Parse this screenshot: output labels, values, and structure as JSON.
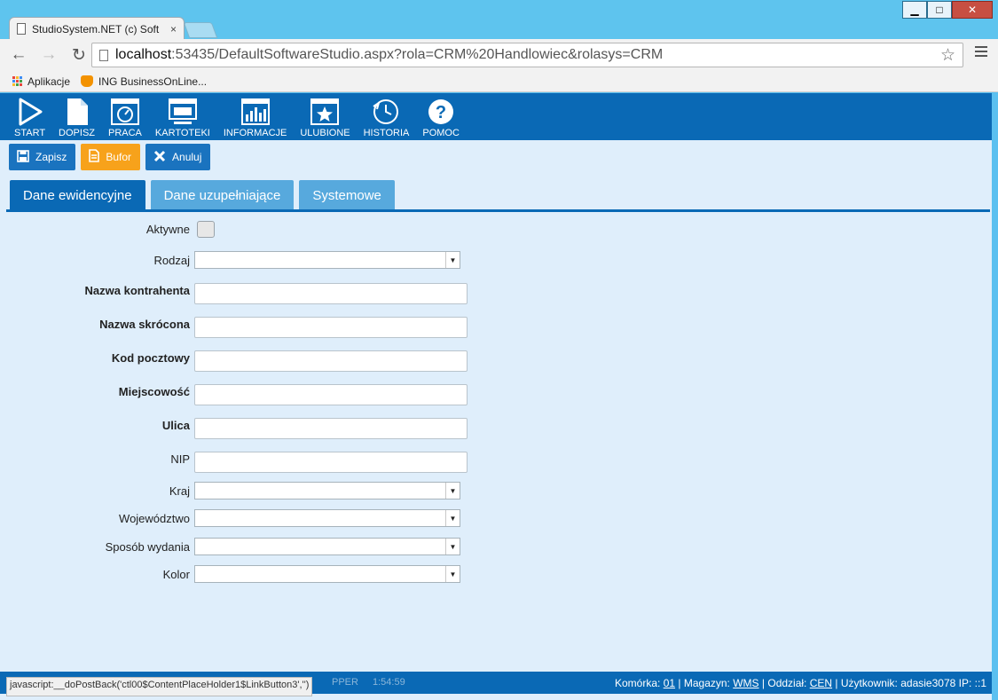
{
  "window": {
    "minimize": "▁",
    "maximize": "□",
    "close": "✕"
  },
  "browser": {
    "tab_title": "StudioSystem.NET (c) Soft",
    "tab_close": "×",
    "url_host": "localhost",
    "url_rest": ":53435/DefaultSoftwareStudio.aspx?rola=CRM%20Handlowiec&rolasys=CRM",
    "bookmarks": [
      {
        "label": "Aplikacje",
        "icon": "apps-grid-icon"
      },
      {
        "label": "ING BusinessOnLine...",
        "icon": "ing-lion-icon"
      }
    ]
  },
  "menu": [
    {
      "label": "START",
      "icon": "play-icon"
    },
    {
      "label": "DOPISZ",
      "icon": "new-document-icon"
    },
    {
      "label": "PRACA",
      "icon": "dashboard-window-icon"
    },
    {
      "label": "KARTOTEKI",
      "icon": "monitor-icon"
    },
    {
      "label": "INFORMACJE",
      "icon": "bar-chart-icon"
    },
    {
      "label": "ULUBIONE",
      "icon": "star-icon"
    },
    {
      "label": "HISTORIA",
      "icon": "history-clock-icon"
    },
    {
      "label": "POMOC",
      "icon": "help-question-icon"
    }
  ],
  "actions": {
    "save": "Zapisz",
    "buffer": "Bufor",
    "cancel": "Anuluj"
  },
  "tabs": [
    "Dane ewidencyjne",
    "Dane uzupełniające",
    "Systemowe"
  ],
  "form": {
    "aktywne": "Aktywne",
    "rodzaj": "Rodzaj",
    "nazwa_kontrahenta": "Nazwa kontrahenta",
    "nazwa_skrocona": "Nazwa skrócona",
    "kod_pocztowy": "Kod pocztowy",
    "miejscowosc": "Miejscowość",
    "ulica": "Ulica",
    "nip": "NIP",
    "kraj": "Kraj",
    "wojewodztwo": "Województwo",
    "sposob_wydania": "Sposób wydania",
    "kolor": "Kolor"
  },
  "footer": {
    "status_url": "javascript:__doPostBack('ctl00$ContentPlaceHolder1$LinkButton3','')",
    "partial_text": "PPER",
    "time": "1:54:59",
    "komorka_label": "Komórka:",
    "komorka_value": "01",
    "magazyn_label": "Magazyn:",
    "magazyn_value": "WMS",
    "oddzial_label": "Oddział:",
    "oddzial_value": "CEN",
    "uzytkownik_label": "Użytkownik:",
    "uzytkownik_value": "adasie3078",
    "ip_label": "IP:",
    "ip_value": "::1"
  },
  "colors": {
    "brand_blue": "#0a69b5",
    "orange": "#f7a21b",
    "light_tab": "#57a9dd",
    "app_bg": "#dfeefb"
  }
}
